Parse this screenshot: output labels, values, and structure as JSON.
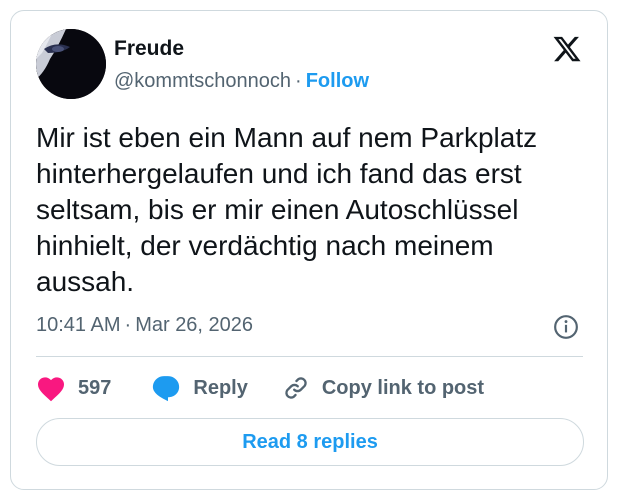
{
  "author": {
    "display_name": "Freude",
    "handle": "@kommtschonnoch",
    "separator": "·",
    "follow_label": "Follow"
  },
  "tweet": {
    "lines": [
      "Mir ist eben ein Mann auf nem Parkplatz",
      "hinterhergelaufen und ich fand das erst",
      "seltsam, bis er mir einen Autoschlüssel",
      "hinhielt, der verdächtig nach meinem",
      "aussah."
    ],
    "time": "10:41 AM",
    "separator": "·",
    "date": "Mar 26, 2026"
  },
  "actions": {
    "like_count": "597",
    "reply_label": "Reply",
    "copy_label": "Copy link to post"
  },
  "read_replies_label": "Read 8 replies",
  "colors": {
    "accent": "#1d9bf0",
    "like": "#f91880",
    "secondary_text": "#536471",
    "border": "#cfd9de"
  },
  "icons": [
    "avatar",
    "x-logo-icon",
    "info-icon",
    "heart-icon",
    "reply-bubble-icon",
    "link-icon"
  ]
}
